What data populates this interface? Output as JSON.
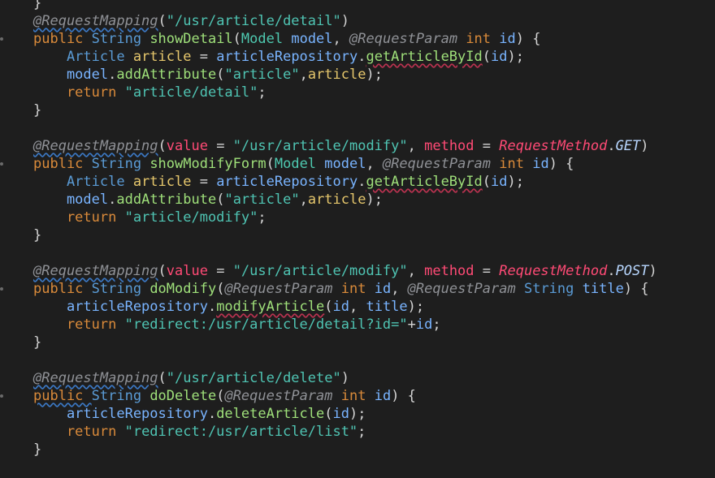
{
  "lines": [
    [
      {
        "t": "}",
        "c": "punc"
      }
    ],
    [
      {
        "t": "@RequestMapping",
        "c": "ann",
        "squig": true
      },
      {
        "t": "(",
        "c": "punc"
      },
      {
        "t": "\"/usr/article/detail\"",
        "c": "str"
      },
      {
        "t": ")",
        "c": "punc"
      }
    ],
    [
      {
        "t": "public ",
        "c": "kw"
      },
      {
        "t": "String ",
        "c": "type"
      },
      {
        "t": "showDetail",
        "c": "fn"
      },
      {
        "t": "(",
        "c": "punc"
      },
      {
        "t": "Model ",
        "c": "class"
      },
      {
        "t": "model",
        "c": "param"
      },
      {
        "t": ", ",
        "c": "punc"
      },
      {
        "t": "@RequestParam ",
        "c": "ann"
      },
      {
        "t": "int ",
        "c": "kw"
      },
      {
        "t": "id",
        "c": "param"
      },
      {
        "t": ") {",
        "c": "punc"
      }
    ],
    [
      {
        "t": "    Article ",
        "c": "type"
      },
      {
        "t": "article",
        "c": "var"
      },
      {
        "t": " = ",
        "c": "punc"
      },
      {
        "t": "articleRepository",
        "c": "param"
      },
      {
        "t": ".",
        "c": "punc"
      },
      {
        "t": "getArticleById",
        "c": "fn",
        "redsquig": true
      },
      {
        "t": "(",
        "c": "punc"
      },
      {
        "t": "id",
        "c": "param"
      },
      {
        "t": ");",
        "c": "punc"
      }
    ],
    [
      {
        "t": "    model",
        "c": "param"
      },
      {
        "t": ".",
        "c": "punc"
      },
      {
        "t": "addAttribute",
        "c": "fn"
      },
      {
        "t": "(",
        "c": "punc"
      },
      {
        "t": "\"article\"",
        "c": "str"
      },
      {
        "t": ",",
        "c": "punc"
      },
      {
        "t": "article",
        "c": "var"
      },
      {
        "t": ");",
        "c": "punc"
      }
    ],
    [
      {
        "t": "    return ",
        "c": "kw"
      },
      {
        "t": "\"article/detail\"",
        "c": "str"
      },
      {
        "t": ";",
        "c": "punc"
      }
    ],
    [
      {
        "t": "}",
        "c": "punc"
      }
    ],
    [],
    [
      {
        "t": "@RequestMapping",
        "c": "ann",
        "squig": true
      },
      {
        "t": "(",
        "c": "punc"
      },
      {
        "t": "value",
        "c": "attr"
      },
      {
        "t": " = ",
        "c": "punc"
      },
      {
        "t": "\"/usr/article/modify\"",
        "c": "str"
      },
      {
        "t": ", ",
        "c": "punc"
      },
      {
        "t": "method",
        "c": "attr"
      },
      {
        "t": " = ",
        "c": "punc"
      },
      {
        "t": "RequestMethod",
        "c": "enum"
      },
      {
        "t": ".",
        "c": "punc"
      },
      {
        "t": "GET",
        "c": "const"
      },
      {
        "t": ")",
        "c": "punc"
      }
    ],
    [
      {
        "t": "public ",
        "c": "kw"
      },
      {
        "t": "String ",
        "c": "type"
      },
      {
        "t": "showModifyForm",
        "c": "fn"
      },
      {
        "t": "(",
        "c": "punc"
      },
      {
        "t": "Model ",
        "c": "class"
      },
      {
        "t": "model",
        "c": "param"
      },
      {
        "t": ", ",
        "c": "punc"
      },
      {
        "t": "@RequestParam ",
        "c": "ann"
      },
      {
        "t": "int ",
        "c": "kw"
      },
      {
        "t": "id",
        "c": "param"
      },
      {
        "t": ") {",
        "c": "punc"
      }
    ],
    [
      {
        "t": "    Article ",
        "c": "type"
      },
      {
        "t": "article",
        "c": "var"
      },
      {
        "t": " = ",
        "c": "punc"
      },
      {
        "t": "articleRepository",
        "c": "param"
      },
      {
        "t": ".",
        "c": "punc"
      },
      {
        "t": "getArticleById",
        "c": "fn",
        "redsquig": true
      },
      {
        "t": "(",
        "c": "punc"
      },
      {
        "t": "id",
        "c": "param"
      },
      {
        "t": ");",
        "c": "punc"
      }
    ],
    [
      {
        "t": "    model",
        "c": "param"
      },
      {
        "t": ".",
        "c": "punc"
      },
      {
        "t": "addAttribute",
        "c": "fn"
      },
      {
        "t": "(",
        "c": "punc"
      },
      {
        "t": "\"article\"",
        "c": "str"
      },
      {
        "t": ",",
        "c": "punc"
      },
      {
        "t": "article",
        "c": "var"
      },
      {
        "t": ");",
        "c": "punc"
      }
    ],
    [
      {
        "t": "    return ",
        "c": "kw"
      },
      {
        "t": "\"article/modify\"",
        "c": "str"
      },
      {
        "t": ";",
        "c": "punc"
      }
    ],
    [
      {
        "t": "}",
        "c": "punc"
      }
    ],
    [],
    [
      {
        "t": "@RequestMapping",
        "c": "ann",
        "squig": true
      },
      {
        "t": "(",
        "c": "punc"
      },
      {
        "t": "value",
        "c": "attr"
      },
      {
        "t": " = ",
        "c": "punc"
      },
      {
        "t": "\"/usr/article/modify\"",
        "c": "str"
      },
      {
        "t": ", ",
        "c": "punc"
      },
      {
        "t": "method",
        "c": "attr"
      },
      {
        "t": " = ",
        "c": "punc"
      },
      {
        "t": "RequestMethod",
        "c": "enum"
      },
      {
        "t": ".",
        "c": "punc"
      },
      {
        "t": "POST",
        "c": "const"
      },
      {
        "t": ")",
        "c": "punc"
      }
    ],
    [
      {
        "t": "public ",
        "c": "kw"
      },
      {
        "t": "String ",
        "c": "type"
      },
      {
        "t": "doModify",
        "c": "fn"
      },
      {
        "t": "(",
        "c": "punc"
      },
      {
        "t": "@RequestParam ",
        "c": "ann"
      },
      {
        "t": "int ",
        "c": "kw"
      },
      {
        "t": "id",
        "c": "param"
      },
      {
        "t": ", ",
        "c": "punc"
      },
      {
        "t": "@RequestParam ",
        "c": "ann"
      },
      {
        "t": "String ",
        "c": "type"
      },
      {
        "t": "title",
        "c": "param"
      },
      {
        "t": ") {",
        "c": "punc"
      }
    ],
    [
      {
        "t": "    articleRepository",
        "c": "param"
      },
      {
        "t": ".",
        "c": "punc"
      },
      {
        "t": "modifyArticle",
        "c": "fn",
        "redsquig": true
      },
      {
        "t": "(",
        "c": "punc"
      },
      {
        "t": "id",
        "c": "param"
      },
      {
        "t": ", ",
        "c": "punc"
      },
      {
        "t": "title",
        "c": "param"
      },
      {
        "t": ");",
        "c": "punc"
      }
    ],
    [
      {
        "t": "    return ",
        "c": "kw"
      },
      {
        "t": "\"redirect:/usr/article/detail?id=\"",
        "c": "str"
      },
      {
        "t": "+",
        "c": "punc"
      },
      {
        "t": "id",
        "c": "param"
      },
      {
        "t": ";",
        "c": "punc"
      }
    ],
    [
      {
        "t": "}",
        "c": "punc"
      }
    ],
    [],
    [
      {
        "t": "@RequestMapping",
        "c": "ann",
        "squig": true
      },
      {
        "t": "(",
        "c": "punc"
      },
      {
        "t": "\"/usr/article/delete\"",
        "c": "str"
      },
      {
        "t": ")",
        "c": "punc"
      }
    ],
    [
      {
        "t": "public ",
        "c": "kw",
        "squig": true
      },
      {
        "t": "String ",
        "c": "type"
      },
      {
        "t": "doDelete",
        "c": "fn"
      },
      {
        "t": "(",
        "c": "punc"
      },
      {
        "t": "@RequestParam ",
        "c": "ann"
      },
      {
        "t": "int ",
        "c": "kw"
      },
      {
        "t": "id",
        "c": "param"
      },
      {
        "t": ") {",
        "c": "punc"
      }
    ],
    [
      {
        "t": "    articleRepository",
        "c": "param"
      },
      {
        "t": ".",
        "c": "punc"
      },
      {
        "t": "deleteArticle",
        "c": "fn"
      },
      {
        "t": "(",
        "c": "punc"
      },
      {
        "t": "id",
        "c": "param"
      },
      {
        "t": ");",
        "c": "punc"
      }
    ],
    [
      {
        "t": "    return ",
        "c": "kw"
      },
      {
        "t": "\"redirect:/usr/article/list\"",
        "c": "str"
      },
      {
        "t": ";",
        "c": "punc"
      }
    ],
    [
      {
        "t": "}",
        "c": "punc"
      }
    ]
  ],
  "gutter_marked_lines": [
    2,
    9,
    16,
    22
  ],
  "colors": {
    "background": "#1e1e1e",
    "keyword": "#d98a3a",
    "type": "#5a9bd5",
    "class": "#4ec9b0",
    "variable": "#e6c76c",
    "function": "#9fe07a",
    "string": "#4fc4b3",
    "annotation": "#8f9196",
    "parameter": "#79b4ff",
    "annotation_attribute": "#ff4a75"
  }
}
